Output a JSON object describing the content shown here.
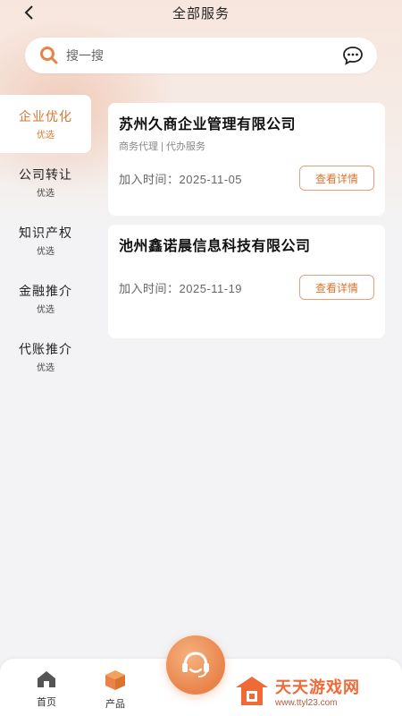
{
  "header": {
    "title": "全部服务",
    "back_icon": "chevron-left-icon"
  },
  "search": {
    "placeholder": "搜一搜",
    "icon": "search-icon",
    "message_icon": "chat-bubble-icon"
  },
  "sidebar": {
    "items": [
      {
        "label": "企业优化",
        "sub": "优选",
        "active": true
      },
      {
        "label": "公司转让",
        "sub": "优选",
        "active": false
      },
      {
        "label": "知识产权",
        "sub": "优选",
        "active": false
      },
      {
        "label": "金融推介",
        "sub": "优选",
        "active": false
      },
      {
        "label": "代账推介",
        "sub": "优选",
        "active": false
      }
    ]
  },
  "companies": [
    {
      "name": "苏州久商企业管理有限公司",
      "tags": "商务代理 | 代办服务",
      "join_date": "加入时间：2025-11-05",
      "button": "查看详情"
    },
    {
      "name": "池州鑫诺晨信息科技有限公司",
      "join_date": "加入时间：2025-11-19",
      "button": "查看详情"
    }
  ],
  "tabbar": {
    "home": "首页",
    "product": "产品",
    "center_icon": "customer-service-icon"
  },
  "watermark": {
    "title": "天天游戏网",
    "url": "www.ttyl23.com"
  },
  "colors": {
    "accent": "#d8742e",
    "orange_btn": "#e9834a",
    "bg": "#f3f3f5"
  }
}
